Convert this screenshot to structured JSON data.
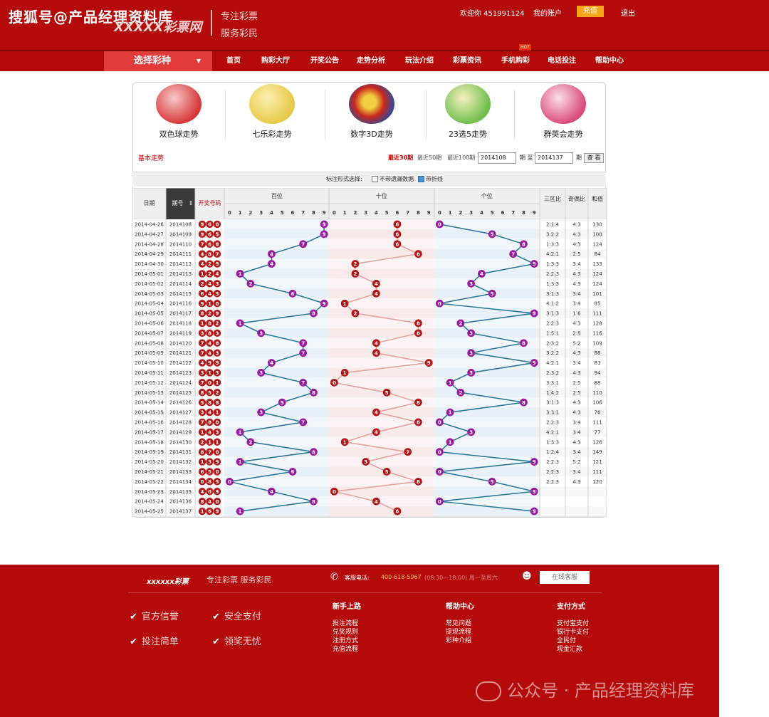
{
  "header": {
    "watermark": "搜狐号@产品经理资料库",
    "logo": "XXXXX彩票网",
    "slogan_line1": "专注彩票",
    "slogan_line2": "服务彩民",
    "welcome": "欢迎你 451991124",
    "my_account": "我的账户",
    "recharge": "充值",
    "logout": "退出"
  },
  "nav": {
    "select_lottery": "选择彩种",
    "items": [
      "首页",
      "购彩大厅",
      "开奖公告",
      "走势分析",
      "玩法介绍",
      "彩票资讯",
      "手机购彩",
      "电话投注",
      "帮助中心"
    ],
    "hot_badge": "HOT"
  },
  "games": [
    {
      "name": "双色球走势",
      "logo": "UNION LOTTO",
      "color": "#d73838"
    },
    {
      "name": "七乐彩走势",
      "logo": "7乐彩",
      "color": "#e8d04a"
    },
    {
      "name": "数字3D走势",
      "logo": "3D",
      "color": "#c8281e"
    },
    {
      "name": "23选5走势",
      "logo": "5",
      "color": "#6fbf4c"
    },
    {
      "name": "群英会走势",
      "logo": "群英会",
      "color": "#d94b7a"
    }
  ],
  "filters": {
    "basic_trend": "基本走势",
    "ranges": [
      "最近30期",
      "最近50期",
      "最近100期"
    ],
    "active_range": "最近30期",
    "from_issue": "2014108",
    "period_label": "期 至",
    "to_issue": "2014137",
    "period_suffix": "期",
    "query": "查 看"
  },
  "format_options": {
    "label": "标注形式选择:",
    "option1": "不带遗漏数据",
    "option1_checked": false,
    "option2": "带折线",
    "option2_checked": true
  },
  "table": {
    "headers": {
      "date": "日期",
      "issue": "期号",
      "draw": "开奖号码",
      "hundreds": "百位",
      "tens": "十位",
      "units": "个位",
      "zone_ratio": "三区比",
      "odd_even": "奇偶比",
      "sum": "和值"
    },
    "digits": [
      "0",
      "1",
      "2",
      "3",
      "4",
      "5",
      "6",
      "7",
      "8",
      "9"
    ],
    "rows": [
      {
        "date": "2014-04-26",
        "issue": "2014108",
        "draw": "960",
        "zone": "2:1:4",
        "oe": "4:3",
        "sum": "130"
      },
      {
        "date": "2014-04-27",
        "issue": "2014109",
        "draw": "965",
        "zone": "3:2:2",
        "oe": "4:3",
        "sum": "100"
      },
      {
        "date": "2014-04-28",
        "issue": "2014110",
        "draw": "768",
        "zone": "1:3:3",
        "oe": "4:3",
        "sum": "124"
      },
      {
        "date": "2014-04-29",
        "issue": "2014111",
        "draw": "487",
        "zone": "4:2:1",
        "oe": "2:5",
        "sum": "84"
      },
      {
        "date": "2014-04-30",
        "issue": "2014112",
        "draw": "429",
        "zone": "1:3:3",
        "oe": "3:4",
        "sum": "133"
      },
      {
        "date": "2014-05-01",
        "issue": "2014113",
        "draw": "124",
        "zone": "2:2:3",
        "oe": "4:3",
        "sum": "124"
      },
      {
        "date": "2014-05-02",
        "issue": "2014114",
        "draw": "243",
        "zone": "1:3:3",
        "oe": "4:3",
        "sum": "124"
      },
      {
        "date": "2014-05-03",
        "issue": "2014115",
        "draw": "645",
        "zone": "3:1:3",
        "oe": "3:4",
        "sum": "101"
      },
      {
        "date": "2014-05-04",
        "issue": "2014116",
        "draw": "910",
        "zone": "4:1:2",
        "oe": "3:4",
        "sum": "85"
      },
      {
        "date": "2014-05-05",
        "issue": "2014117",
        "draw": "829",
        "zone": "3:1:3",
        "oe": "1:6",
        "sum": "111"
      },
      {
        "date": "2014-05-06",
        "issue": "2014118",
        "draw": "182",
        "zone": "2:2:3",
        "oe": "4:3",
        "sum": "128"
      },
      {
        "date": "2014-05-07",
        "issue": "2014119",
        "draw": "383",
        "zone": "1:5:1",
        "oe": "2:5",
        "sum": "116"
      },
      {
        "date": "2014-05-08",
        "issue": "2014120",
        "draw": "748",
        "zone": "2:3:2",
        "oe": "5:2",
        "sum": "109"
      },
      {
        "date": "2014-05-09",
        "issue": "2014121",
        "draw": "743",
        "zone": "3:2:2",
        "oe": "4:3",
        "sum": "88"
      },
      {
        "date": "2014-05-10",
        "issue": "2014122",
        "draw": "499",
        "zone": "4:2:1",
        "oe": "3:4",
        "sum": "81"
      },
      {
        "date": "2014-05-11",
        "issue": "2014123",
        "draw": "313",
        "zone": "2:3:2",
        "oe": "4:3",
        "sum": "94"
      },
      {
        "date": "2014-05-12",
        "issue": "2014124",
        "draw": "701",
        "zone": "3:3:1",
        "oe": "2:5",
        "sum": "88"
      },
      {
        "date": "2014-05-13",
        "issue": "2014125",
        "draw": "852",
        "zone": "1:4:2",
        "oe": "2:5",
        "sum": "110"
      },
      {
        "date": "2014-05-14",
        "issue": "2014126",
        "draw": "588",
        "zone": "3:1:3",
        "oe": "4:3",
        "sum": "106"
      },
      {
        "date": "2014-05-15",
        "issue": "2014127",
        "draw": "341",
        "zone": "3:3:1",
        "oe": "4:3",
        "sum": "76"
      },
      {
        "date": "2014-05-16",
        "issue": "2014128",
        "draw": "780",
        "zone": "2:2:3",
        "oe": "3:4",
        "sum": "111"
      },
      {
        "date": "2014-05-17",
        "issue": "2014129",
        "draw": "143",
        "zone": "4:2:1",
        "oe": "3:4",
        "sum": "77"
      },
      {
        "date": "2014-05-18",
        "issue": "2014130",
        "draw": "211",
        "zone": "1:3:3",
        "oe": "4:3",
        "sum": "126"
      },
      {
        "date": "2014-05-19",
        "issue": "2014131",
        "draw": "870",
        "zone": "1:2:4",
        "oe": "3:4",
        "sum": "149"
      },
      {
        "date": "2014-05-20",
        "issue": "2014132",
        "draw": "139",
        "zone": "2:2:3",
        "oe": "5:2",
        "sum": "121"
      },
      {
        "date": "2014-05-21",
        "issue": "2014133",
        "draw": "650",
        "zone": "2:2:3",
        "oe": "3:4",
        "sum": "111"
      },
      {
        "date": "2014-05-22",
        "issue": "2014134",
        "draw": "085",
        "zone": "2:2:3",
        "oe": "4:3",
        "sum": "120"
      },
      {
        "date": "2014-05-23",
        "issue": "2014135",
        "draw": "409"
      },
      {
        "date": "2014-05-24",
        "issue": "2014136",
        "draw": "840"
      },
      {
        "date": "2014-05-25",
        "issue": "2014137",
        "draw": "169"
      }
    ]
  },
  "colors": {
    "brand_red": "#b40a0a",
    "draw_ball": "#b41818",
    "trend_ball": "#9a1aa0",
    "hundreds_line": "#2c7a9a",
    "tens_line": "#e7a0a0",
    "units_line": "#2c7a9a"
  },
  "footer": {
    "brand": "xxxxxx彩票",
    "slogan": "专注彩票  服务彩民",
    "phone_label": "客服电话:",
    "phone": "400-618-5967",
    "hours": "(08:30—18:00) 周一至周六",
    "online_service": "在线客服",
    "features": [
      "官方信誉",
      "安全支付",
      "投注简单",
      "领奖无忧"
    ],
    "columns": [
      {
        "title": "新手上路",
        "links": [
          "投注流程",
          "兑奖规则",
          "注册方式",
          "充值流程"
        ]
      },
      {
        "title": "帮助中心",
        "links": [
          "常见问题",
          "提现流程",
          "彩种介绍"
        ]
      },
      {
        "title": "支付方式",
        "links": [
          "支付宝支付",
          "银行卡支付",
          "全民付",
          "现金汇款"
        ]
      }
    ],
    "watermark": "公众号 · 产品经理资料库"
  }
}
